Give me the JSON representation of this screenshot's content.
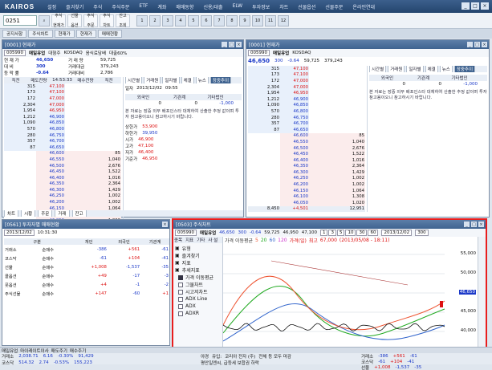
{
  "app": {
    "logo": "KAIROS",
    "menu": [
      "설정",
      "즐겨찾기",
      "주식",
      "주식주문",
      "ETF",
      "계좌",
      "매매동향",
      "신용/대출",
      "ELW",
      "투자정보",
      "차트",
      "선물옵션",
      "선물주문",
      "온라인연대"
    ]
  },
  "toolbar": {
    "code": "0251",
    "buttons": [
      [
        "주식",
        "현재가"
      ],
      [
        "선물",
        "옵션"
      ],
      [
        "주식",
        "주문"
      ],
      [
        "주식",
        "차트"
      ],
      [
        "잔고",
        "조회"
      ]
    ],
    "small": [
      "1",
      "2",
      "3",
      "4",
      "5",
      "6",
      "7",
      "8",
      "9",
      "10",
      "11",
      "12"
    ]
  },
  "tabs": [
    "공지사항",
    "주식차트",
    "현재가",
    "현재가",
    "매매현황"
  ],
  "quote": {
    "title": "[0001] 현재가",
    "code": "005990",
    "name": "매일유업",
    "market": "대형주",
    "mkt2": "KOSDAQ",
    "status": "음식료담배",
    "trade": "대출60%",
    "price": "46,650",
    "high_lbl": "거 래 량",
    "vol": "59,725",
    "prev_lbl": "전일대비",
    "chg": "300",
    "chg2": "-0.64",
    "rows": [
      [
        "현 재 가",
        "46,650",
        "거 래 량",
        "59,725"
      ],
      [
        "대    비",
        "300",
        "거래대금",
        "379,243"
      ],
      [
        "등 락 률",
        "-0.64",
        "거래대비",
        "2,786"
      ]
    ],
    "ob_header": [
      "직전",
      "매도잔량",
      "14:53:33",
      "매수잔량",
      "직전"
    ],
    "asks": [
      [
        "315",
        "47,100"
      ],
      [
        "173",
        "47,100"
      ],
      [
        "172",
        "47,000"
      ],
      [
        "2,304",
        "47,000"
      ],
      [
        "1,954",
        "46,950"
      ],
      [
        "1,212",
        "46,900"
      ],
      [
        "1,090",
        "46,850"
      ],
      [
        "570",
        "46,800"
      ],
      [
        "280",
        "46,750"
      ],
      [
        "357",
        "46,700"
      ],
      [
        "87",
        "46,650"
      ]
    ],
    "bids": [
      [
        "46,600",
        "85"
      ],
      [
        "46,550",
        "1,040"
      ],
      [
        "46,500",
        "2,676"
      ],
      [
        "46,450",
        "1,522"
      ],
      [
        "46,400",
        "1,016"
      ],
      [
        "46,350",
        "2,364"
      ],
      [
        "46,300",
        "1,429"
      ],
      [
        "46,250",
        "1,002"
      ],
      [
        "46,200",
        "1,002"
      ],
      [
        "46,150",
        "1,064"
      ],
      [
        "46,100",
        "1,308"
      ],
      [
        "46,050",
        "1,020"
      ]
    ],
    "total": [
      "8,450",
      "+4,501",
      "12,951"
    ],
    "side": [
      [
        "상한가",
        "53,900"
      ],
      [
        "하한가",
        "39,950"
      ],
      [
        "시가",
        "46,900"
      ],
      [
        "고가",
        "47,100"
      ],
      [
        "저가",
        "46,400"
      ],
      [
        "기준가",
        "46,950"
      ]
    ],
    "tabs": [
      "차트",
      "시황",
      "주문",
      "거래",
      "잔고"
    ],
    "sub_tabs": [
      "시간별",
      "거래원",
      "일자별",
      "체결",
      "뉴스",
      "장중추이"
    ],
    "info_head": [
      "외국인",
      "기관계",
      "기타법인"
    ],
    "info_vals": [
      "0",
      "0",
      "-1,000"
    ],
    "note": "본 자료는 장중 외부 배포인스타 대체하여 산출한 추정 값이며 투자 참고용이오니 참고하시기 바랍니다.",
    "date": "2013/12/02",
    "time": "09:55"
  },
  "quote2": {
    "title": "[0001] 현재가",
    "code": "005990",
    "price": "46,650",
    "chg": "300",
    "rate": "-0.64",
    "vol": "59,725",
    "amt": "379,243"
  },
  "flow": {
    "title": "[0561] 투자자별 매매현황",
    "time": "10:31:30",
    "date": "2013/12/02",
    "cols": [
      "구분",
      "개인",
      "외국인",
      "기관계"
    ],
    "rows": [
      [
        "거래소",
        "순매수",
        "-386",
        "+561",
        "-61"
      ],
      [
        "코스닥",
        "순매수",
        "-61",
        "+104",
        "-41"
      ],
      [
        "선물",
        "순매수",
        "+1,008",
        "-1,537",
        "-35"
      ],
      [
        "콜옵션",
        "순매수",
        "+49",
        "-17",
        "-3"
      ],
      [
        "풋옵션",
        "순매수",
        "+4",
        "-1",
        "-2"
      ],
      [
        "주식선물",
        "순매수",
        "+147",
        "-60",
        "+1"
      ]
    ]
  },
  "chart": {
    "title": "[0503] 주식차트",
    "code": "005990",
    "name": "매일유업",
    "price": "46,650",
    "chg": "300",
    "rate": "-0.64",
    "vol": "59,725",
    "open": "46,950",
    "high": "47,100",
    "periods": [
      "1",
      "3",
      "5",
      "10",
      "30",
      "60"
    ],
    "date": "2013/12/02",
    "count": "300",
    "legend": [
      "가격 이동평균",
      "5",
      "20",
      "60",
      "120",
      "가격(일)",
      "최고",
      "67,000",
      "(2013/05/08 - 18:11)"
    ],
    "tree_head": [
      "종목",
      "지표",
      "기타",
      "사 설"
    ],
    "tree": [
      "유형",
      "즐겨찾기",
      "지표",
      "추세지표",
      "가격 이동평균",
      "그물차트",
      "시고저차트",
      "ADX Line",
      "ADX",
      "ADXR"
    ],
    "yaxis": [
      "55,000",
      "50,000",
      "46,650",
      "45,000",
      "40,000",
      "35,000"
    ]
  },
  "status": {
    "left_tabs": [
      "매일유업",
      "마이레이트이사",
      "매도주기",
      "매수주기"
    ],
    "idx": [
      [
        "거래소",
        "2,038.71",
        "6.16",
        "-0.30%",
        "91,429"
      ],
      [
        "코스닥",
        "514.32",
        "2.74",
        "-0.53%",
        "155,223"
      ]
    ],
    "ticker": [
      "야경",
      "유입:",
      "코리아 전자 (주)",
      "전체 등 모두 마감"
    ],
    "news": "평안일엔씨, 급등세 보합권 하락",
    "right": [
      [
        "거래소",
        "-386",
        "+561",
        "-61"
      ],
      [
        "코스닥",
        "-61",
        "+104",
        "-41"
      ],
      [
        "선물",
        "+1,008",
        "-1,537",
        "-35"
      ]
    ]
  },
  "colors": {
    "accent": "#3f6390",
    "up": "#d11111",
    "down": "#1a38c8",
    "frame": "#e81d1d"
  }
}
